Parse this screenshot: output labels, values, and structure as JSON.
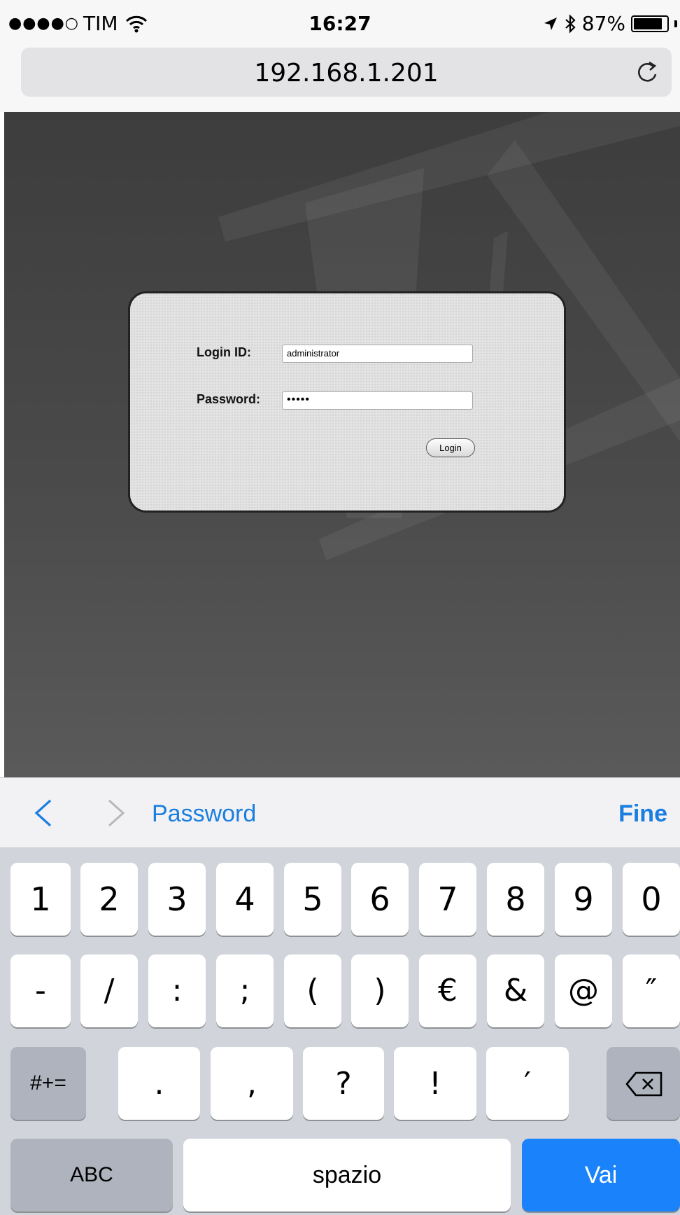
{
  "status_bar": {
    "carrier_signal": "●●●●○",
    "carrier": "TIM",
    "time": "16:27",
    "location_icon": "location-arrow-icon",
    "bluetooth_icon": "bluetooth-icon",
    "battery_percent": "87%",
    "battery_level": 0.87
  },
  "browser": {
    "url": "192.168.1.201",
    "reload_icon": "reload-icon"
  },
  "login_form": {
    "login_id_label": "Login ID:",
    "login_id_value": "administrator",
    "password_label": "Password:",
    "password_value": "•••••",
    "login_button": "Login"
  },
  "keyboard_toolbar": {
    "prev_icon": "chevron-left-icon",
    "next_icon": "chevron-right-icon",
    "field_name": "Password",
    "done_label": "Fine"
  },
  "keyboard": {
    "row1": [
      "1",
      "2",
      "3",
      "4",
      "5",
      "6",
      "7",
      "8",
      "9",
      "0"
    ],
    "row2": [
      "-",
      "/",
      ":",
      ";",
      "(",
      ")",
      "€",
      "&",
      "@",
      "″"
    ],
    "row3_mode": "#+=",
    "row3": [
      ".",
      ",",
      "?",
      "!",
      "′"
    ],
    "backspace_icon": "backspace-icon",
    "abc_label": "ABC",
    "space_label": "spazio",
    "go_label": "Vai"
  },
  "colors": {
    "accent": "#1a7ee0",
    "go_key": "#1a82fb",
    "keyboard_bg": "#d1d4da"
  }
}
